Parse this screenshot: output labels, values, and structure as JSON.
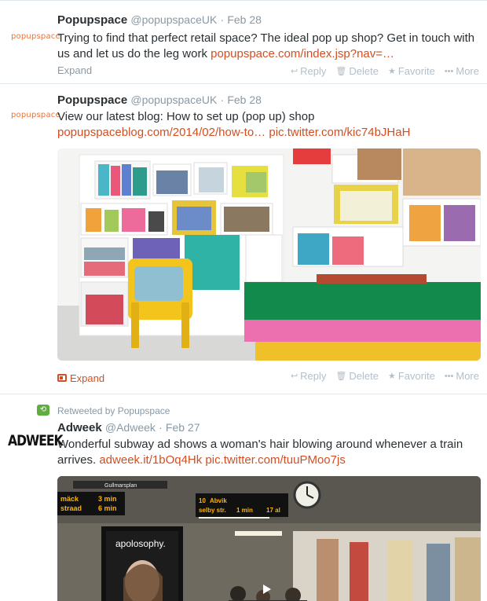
{
  "tweets": [
    {
      "avatar_text": "popupspace",
      "fullname": "Popupspace",
      "handle": "@popupspaceUK",
      "time": "Feb 28",
      "text": "Trying to find that perfect retail space? The ideal pop up shop? Get in touch with us and let us do the leg work ",
      "link": "popupspace.com/index.jsp?nav=…",
      "expand": "Expand"
    },
    {
      "avatar_text": "popupspace",
      "fullname": "Popupspace",
      "handle": "@popupspaceUK",
      "time": "Feb 28",
      "text": "View our latest blog: How to set up (pop up) shop",
      "link1": "popupspaceblog.com/2014/02/how-to…",
      "link2": "pic.twitter.com/kic74bJHaH",
      "expand": "Expand"
    },
    {
      "retweeted_by": "Retweeted by Popupspace",
      "avatar_text": "ADWEEK",
      "fullname": "Adweek",
      "handle": "@Adweek",
      "time": "Feb 27",
      "text": "Wonderful subway ad shows a woman's hair blowing around whenever a train arrives. ",
      "link1": "adweek.it/1bOq4Hk",
      "link2": "pic.twitter.com/tuuPMoo7js",
      "media_text": {
        "brand": "apolosophy.",
        "sign1": "Gullmarsplan",
        "board_left_1": "3 min",
        "board_left_2": "6 min",
        "board_left_label1": "mäck",
        "board_left_label2": "straad",
        "board_right_label1": "Abvik",
        "board_right_label2": "selby str.",
        "board_right_val1": "10",
        "board_right_val2": "1 min",
        "board_right_val3": "17 al"
      }
    }
  ],
  "actions": {
    "reply": "Reply",
    "delete": "Delete",
    "favorite": "Favorite",
    "more": "More"
  },
  "colors": {
    "link": "#d14f22",
    "muted": "#8899a6",
    "retweet": "#5ead3e"
  }
}
